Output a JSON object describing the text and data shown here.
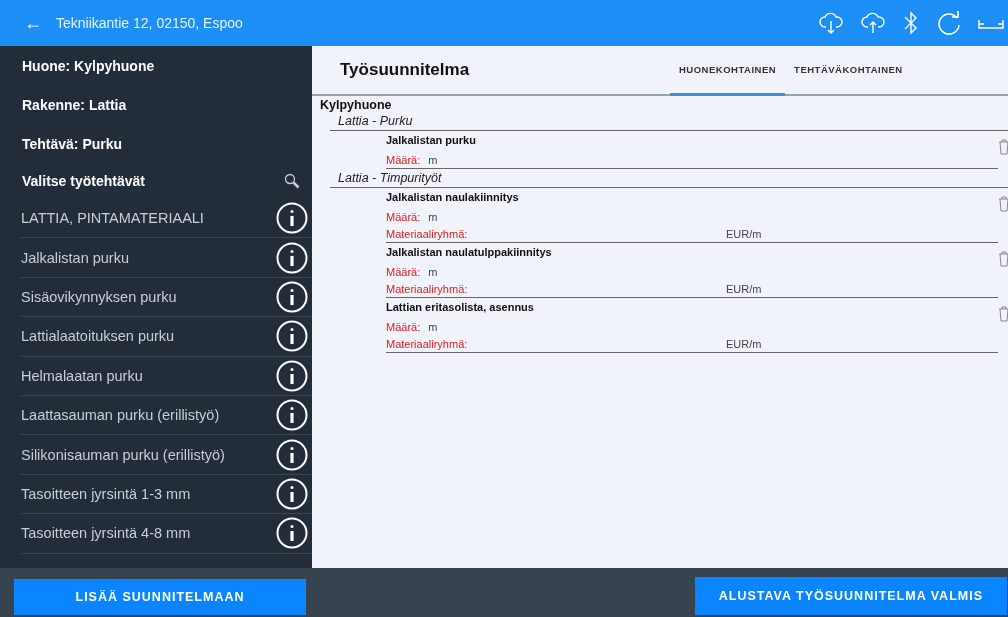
{
  "top_bar": {
    "back": "←",
    "title": "Tekniikantie 12, 02150, Espoo"
  },
  "sidebar": {
    "headings": [
      "Huone: Kylpyhuone",
      "Rakenne: Lattia",
      "Tehtävä: Purku"
    ],
    "list_title": "Valitse työtehtävät",
    "items": [
      {
        "label": "LATTIA, PINTAMATERIAALI"
      },
      {
        "label": "Jalkalistan purku"
      },
      {
        "label": "Sisäovikynnyksen purku"
      },
      {
        "label": "Lattialaatoituksen purku"
      },
      {
        "label": "Helmalaatan purku"
      },
      {
        "label": "Laattasauman purku (erillistyö)"
      },
      {
        "label": "Silikonisauman purku (erillistyö)"
      },
      {
        "label": "Tasoitteen jyrsintä 1-3 mm"
      },
      {
        "label": "Tasoitteen jyrsintä 4-8 mm"
      }
    ]
  },
  "main": {
    "title": "Työsuunnitelma",
    "tabs": [
      {
        "label": "HUONEKOHTAINEN",
        "selected": true
      },
      {
        "label": "TEHTÄVÄKOHTAINEN",
        "selected": false
      }
    ],
    "room": "Kylpyhuone",
    "groups": [
      {
        "title": "Lattia - Purku",
        "tasks": [
          {
            "name": "Jalkalistan purku",
            "fields": [
              {
                "label": "Määrä:",
                "value": "m"
              }
            ]
          }
        ]
      },
      {
        "title": "Lattia - Timpurityöt",
        "tasks": [
          {
            "name": "Jalkalistan naulakiinnitys",
            "fields": [
              {
                "label": "Määrä:",
                "value": "m"
              },
              {
                "label": "Materiaaliryhmä:",
                "unit": "EUR/m"
              }
            ]
          },
          {
            "name": "Jalkalistan naulatulppakiinnitys",
            "fields": [
              {
                "label": "Määrä:",
                "value": "m"
              },
              {
                "label": "Materiaaliryhmä:",
                "unit": "EUR/m"
              }
            ]
          },
          {
            "name": "Lattian eritasolista, asennus",
            "fields": [
              {
                "label": "Määrä:",
                "value": "m"
              },
              {
                "label": "Materiaaliryhmä:",
                "unit": "EUR/m"
              }
            ]
          }
        ]
      }
    ]
  },
  "buttons": {
    "add": "LISÄÄ SUUNNITELMAAN",
    "done": "ALUSTAVA TYÖSUUNNITELMA VALMIS"
  }
}
